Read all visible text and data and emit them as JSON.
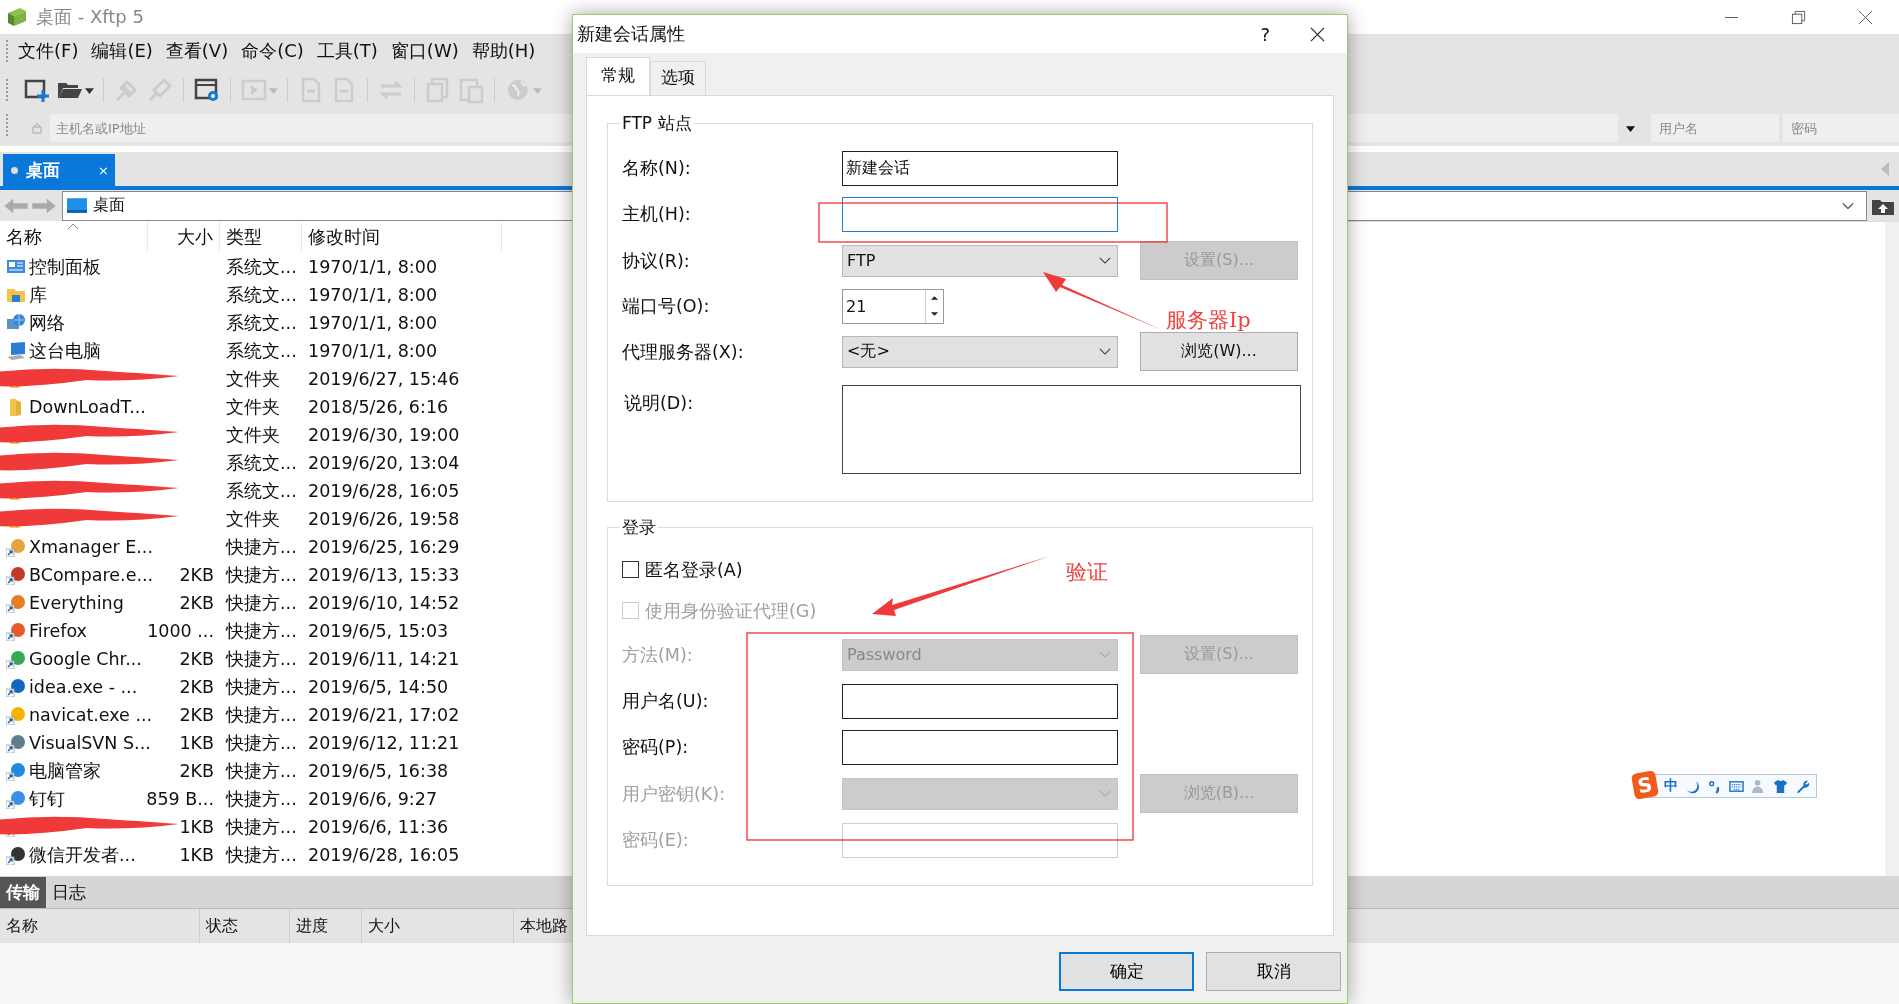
{
  "window": {
    "title": "桌面 - Xftp 5"
  },
  "menu": [
    "文件(F)",
    "编辑(E)",
    "查看(V)",
    "命令(C)",
    "工具(T)",
    "窗口(W)",
    "帮助(H)"
  ],
  "address_bar": {
    "placeholder": "主机名或IP地址",
    "username_placeholder": "用户名",
    "password_placeholder": "密码"
  },
  "session_tabs": [
    {
      "label": "桌面",
      "close": "×",
      "selected": true
    }
  ],
  "path": {
    "value": "桌面"
  },
  "file_list": {
    "columns": [
      {
        "label": "名称",
        "sorted": true
      },
      {
        "label": "大小",
        "sorted": false
      },
      {
        "label": "类型",
        "sorted": false
      },
      {
        "label": "修改时间",
        "sorted": false
      }
    ],
    "rows": [
      {
        "kind": "panel",
        "name": "控制面板",
        "type": "系统文...",
        "modified": "1970/1/1, 8:00",
        "redacted": false
      },
      {
        "kind": "library",
        "name": "库",
        "type": "系统文...",
        "modified": "1970/1/1, 8:00",
        "redacted": false
      },
      {
        "kind": "network",
        "name": "网络",
        "type": "系统文...",
        "modified": "1970/1/1, 8:00",
        "redacted": false
      },
      {
        "kind": "computer",
        "name": "这台电脑",
        "type": "系统文...",
        "modified": "1970/1/1, 8:00",
        "redacted": false
      },
      {
        "kind": "folder",
        "type": "文件夹",
        "modified": "2019/6/27, 15:46",
        "redacted": true
      },
      {
        "kind": "folder",
        "name": "DownLoadT...",
        "type": "文件夹",
        "modified": "2018/5/26, 6:16",
        "redacted": false
      },
      {
        "kind": "folder",
        "type": "文件夹",
        "modified": "2019/6/30, 19:00",
        "redacted": true
      },
      {
        "kind": "network",
        "type": "系统文...",
        "modified": "2019/6/20, 13:04",
        "redacted": true
      },
      {
        "kind": "folder",
        "type": "系统文...",
        "modified": "2019/6/28, 16:05",
        "redacted": true
      },
      {
        "kind": "folder",
        "type": "文件夹",
        "modified": "2019/6/26, 19:58",
        "redacted": true
      },
      {
        "kind": "shortcut",
        "name": "Xmanager E...",
        "type": "快捷方...",
        "modified": "2019/6/25, 16:29",
        "redacted": false
      },
      {
        "kind": "shortcut",
        "name": "BCompare.e...",
        "size": "2KB",
        "type": "快捷方...",
        "modified": "2019/6/13, 15:33",
        "redacted": false
      },
      {
        "kind": "shortcut",
        "name": "Everything",
        "size": "2KB",
        "type": "快捷方...",
        "modified": "2019/6/10, 14:52",
        "redacted": false
      },
      {
        "kind": "shortcut",
        "name": "Firefox",
        "size": "1000 ...",
        "type": "快捷方...",
        "modified": "2019/6/5, 15:03",
        "redacted": false
      },
      {
        "kind": "shortcut",
        "name": "Google Chr...",
        "size": "2KB",
        "type": "快捷方...",
        "modified": "2019/6/11, 14:21",
        "redacted": false
      },
      {
        "kind": "shortcut",
        "name": "idea.exe - ...",
        "size": "2KB",
        "type": "快捷方...",
        "modified": "2019/6/5, 14:50",
        "redacted": false
      },
      {
        "kind": "shortcut",
        "name": "navicat.exe ...",
        "size": "2KB",
        "type": "快捷方...",
        "modified": "2019/6/21, 17:02",
        "redacted": false
      },
      {
        "kind": "shortcut",
        "name": "VisualSVN S...",
        "size": "1KB",
        "type": "快捷方...",
        "modified": "2019/6/12, 11:21",
        "redacted": false
      },
      {
        "kind": "shortcut",
        "name": "电脑管家",
        "size": "2KB",
        "type": "快捷方...",
        "modified": "2019/6/5, 16:38",
        "redacted": false
      },
      {
        "kind": "shortcut",
        "name": "钉钉",
        "size": "859 B...",
        "type": "快捷方...",
        "modified": "2019/6/6, 9:27",
        "redacted": false
      },
      {
        "kind": "shortcut",
        "size": "1KB",
        "type": "快捷方...",
        "modified": "2019/6/6, 11:36",
        "redacted": true
      },
      {
        "kind": "shortcut",
        "name": "微信开发者...",
        "size": "1KB",
        "type": "快捷方...",
        "modified": "2019/6/28, 16:05",
        "redacted": false
      }
    ]
  },
  "bottom_panel": {
    "tabs": [
      {
        "label": "传输",
        "selected": true
      },
      {
        "label": "日志",
        "selected": false
      }
    ],
    "columns": [
      "名称",
      "状态",
      "进度",
      "大小",
      "本地路"
    ]
  },
  "ime_toolbar": {
    "logo": "S",
    "mode": "中"
  },
  "dialog": {
    "title": "新建会话属性",
    "help": "?",
    "tabs": [
      {
        "label": "常规",
        "selected": true
      },
      {
        "label": "选项",
        "selected": false
      }
    ],
    "groups": [
      {
        "legend": "FTP 站点",
        "rows": [
          {
            "kind": "text",
            "label": "名称(N):",
            "value": "新建会话",
            "focused": false,
            "disabled": false
          },
          {
            "kind": "text",
            "label": "主机(H):",
            "focused": true,
            "disabled": false
          },
          {
            "kind": "select",
            "label": "协议(R):",
            "value": "FTP",
            "disabled": false,
            "button": {
              "label": "设置(S)...",
              "disabled": true
            }
          },
          {
            "kind": "spin",
            "label": "端口号(O):",
            "value": "21"
          },
          {
            "kind": "select",
            "label": "代理服务器(X):",
            "value": "<无>",
            "disabled": false,
            "button": {
              "label": "浏览(W)...",
              "disabled": false
            }
          },
          {
            "kind": "textarea",
            "label": "说明(D):"
          }
        ]
      },
      {
        "legend": "登录",
        "rows": [
          {
            "kind": "check",
            "label": "匿名登录(A)",
            "checked": false,
            "disabled": false
          },
          {
            "kind": "check",
            "label": "使用身份验证代理(G)",
            "checked": false,
            "disabled": true
          },
          {
            "kind": "select",
            "label": "方法(M):",
            "value": "Password",
            "disabled": true,
            "button": {
              "label": "设置(S)...",
              "disabled": true
            }
          },
          {
            "kind": "text",
            "label": "用户名(U):",
            "focused": false,
            "disabled": false
          },
          {
            "kind": "text",
            "label": "密码(P):",
            "focused": false,
            "disabled": false
          },
          {
            "kind": "select",
            "label": "用户密钥(K):",
            "disabled": true,
            "button": {
              "label": "浏览(B)...",
              "disabled": true
            }
          },
          {
            "kind": "text",
            "label": "密码(E):",
            "focused": false,
            "disabled": true
          }
        ]
      }
    ],
    "buttons": [
      {
        "label": "确定",
        "default": true
      },
      {
        "label": "取消",
        "default": false
      }
    ]
  },
  "annotations": [
    {
      "text": "服务器Ip"
    },
    {
      "text": "验证"
    }
  ]
}
